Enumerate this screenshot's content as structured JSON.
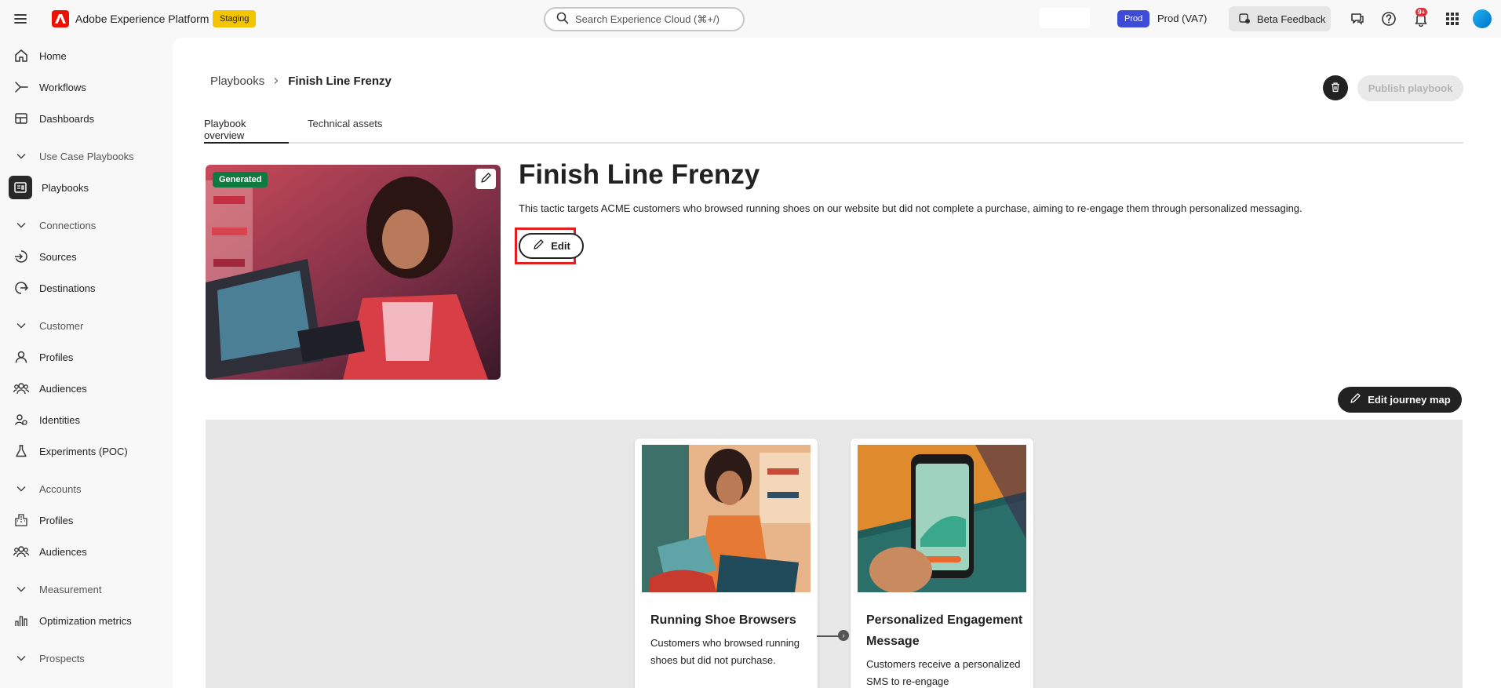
{
  "app": {
    "name": "Adobe Experience Platform",
    "env_badge": "Staging",
    "search_placeholder": "Search Experience Cloud (⌘+/)",
    "org_badge": "Prod",
    "org_label": "Prod (VA7)",
    "beta_feedback": "Beta Feedback",
    "notification_count": "9+"
  },
  "sidebar": {
    "items": [
      {
        "label": "Home",
        "icon": "home-icon",
        "type": "link"
      },
      {
        "label": "Workflows",
        "icon": "workflows-icon",
        "type": "link"
      },
      {
        "label": "Dashboards",
        "icon": "dashboards-icon",
        "type": "link"
      },
      {
        "label": "Use Case Playbooks",
        "icon": "chevron-down-icon",
        "type": "section"
      },
      {
        "label": "Playbooks",
        "icon": "playbooks-icon",
        "type": "link",
        "active": true
      },
      {
        "label": "Connections",
        "icon": "chevron-down-icon",
        "type": "section"
      },
      {
        "label": "Sources",
        "icon": "sources-icon",
        "type": "link"
      },
      {
        "label": "Destinations",
        "icon": "destinations-icon",
        "type": "link"
      },
      {
        "label": "Customer",
        "icon": "chevron-down-icon",
        "type": "section"
      },
      {
        "label": "Profiles",
        "icon": "profile-icon",
        "type": "link"
      },
      {
        "label": "Audiences",
        "icon": "audiences-icon",
        "type": "link"
      },
      {
        "label": "Identities",
        "icon": "identities-icon",
        "type": "link"
      },
      {
        "label": "Experiments (POC)",
        "icon": "flask-icon",
        "type": "link"
      },
      {
        "label": "Accounts",
        "icon": "chevron-down-icon",
        "type": "section"
      },
      {
        "label": "Profiles",
        "icon": "building-icon",
        "type": "link"
      },
      {
        "label": "Audiences",
        "icon": "audiences-icon",
        "type": "link"
      },
      {
        "label": "Measurement",
        "icon": "chevron-down-icon",
        "type": "section"
      },
      {
        "label": "Optimization metrics",
        "icon": "metrics-icon",
        "type": "link"
      },
      {
        "label": "Prospects",
        "icon": "chevron-down-icon",
        "type": "section"
      }
    ]
  },
  "breadcrumb": {
    "parent": "Playbooks",
    "current": "Finish Line Frenzy"
  },
  "actions": {
    "publish": "Publish playbook",
    "edit": "Edit",
    "edit_journey_map": "Edit journey map"
  },
  "tabs": [
    {
      "label": "Playbook overview",
      "active": true
    },
    {
      "label": "Technical assets",
      "active": false
    }
  ],
  "playbook": {
    "badge": "Generated",
    "title": "Finish Line Frenzy",
    "description": "This tactic targets ACME customers who browsed running shoes on our website but did not complete a purchase, aiming to re-engage them through personalized messaging."
  },
  "journey": {
    "cards": [
      {
        "title": "Running Shoe Browsers",
        "text": "Customers who browsed running shoes but did not purchase."
      },
      {
        "title": "Personalized Engagement Message",
        "text": "Customers receive a personalized SMS to re-engage"
      }
    ]
  }
}
